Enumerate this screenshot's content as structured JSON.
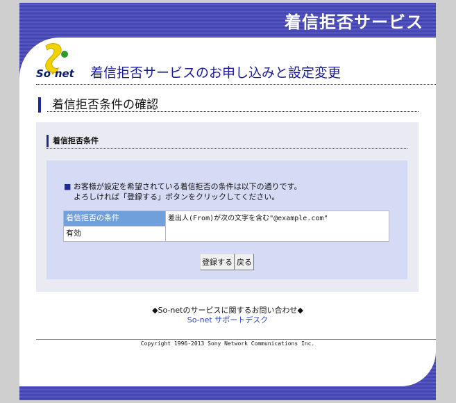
{
  "header": {
    "banner_title": "着信拒否サービス",
    "logo_text_a": "So",
    "logo_text_b": "net",
    "app_title": "着信拒否サービスのお申し込みと設定変更"
  },
  "section": {
    "title": "着信拒否条件の確認",
    "subheading": "着信拒否条件"
  },
  "info": {
    "bullet": "■",
    "line1": "お客様が設定を希望されている着信拒否の条件は以下の通りです。",
    "line2": "よろしければ「登録する」ボタンをクリックしてください。"
  },
  "conditions": {
    "header_label": "着信拒否の条件",
    "status_label": "有効",
    "value": "差出人(From)が次の文字を含む\"@example.com\""
  },
  "buttons": {
    "register": "登録する",
    "back": "戻る"
  },
  "footer": {
    "inquiry": "◆So-netのサービスに関するお問い合わせ◆",
    "support_link": "So-net サポートデスク",
    "copyright": "Copyright 1996-2013 Sony Network Communications Inc."
  },
  "colors": {
    "brand_navy": "#1e2a9c",
    "banner_blue": "#4a4ab8",
    "table_header": "#6fa0dc",
    "inner_box": "#d5daf5"
  }
}
